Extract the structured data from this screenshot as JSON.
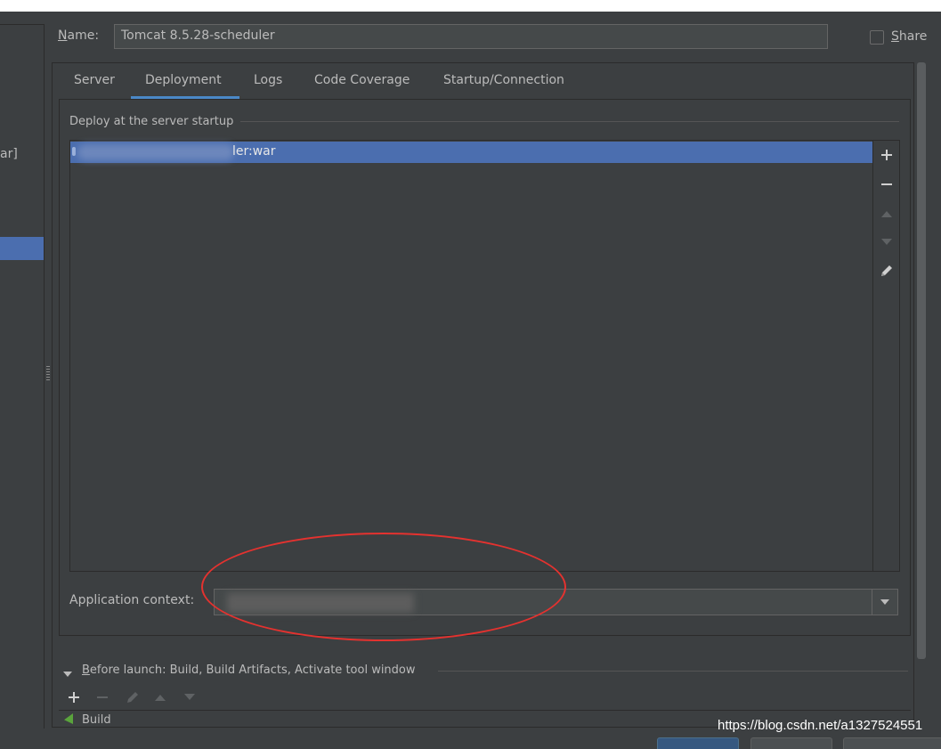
{
  "dialog": {
    "name_label": "Name:",
    "name_value": "Tomcat 8.5.28-scheduler",
    "share_label": "Share",
    "share_checked": false
  },
  "left_panel": {
    "fragment_text": "ar]"
  },
  "tabs": [
    {
      "label": "Server",
      "selected": false
    },
    {
      "label": "Deployment",
      "selected": true
    },
    {
      "label": "Logs",
      "selected": false
    },
    {
      "label": "Code Coverage",
      "selected": false
    },
    {
      "label": "Startup/Connection",
      "selected": false
    }
  ],
  "deployment": {
    "group_title": "Deploy at the server startup",
    "artifacts": [
      {
        "visible_suffix": "ler:war",
        "selected": true
      }
    ],
    "side_tools": [
      {
        "icon": "plus-icon",
        "enabled": true
      },
      {
        "icon": "minus-icon",
        "enabled": true
      },
      {
        "icon": "move-up-icon",
        "enabled": false
      },
      {
        "icon": "move-down-icon",
        "enabled": false
      },
      {
        "icon": "pencil-icon",
        "enabled": true
      }
    ],
    "app_context_label": "Application context:"
  },
  "before_launch": {
    "label_prefix": "B",
    "label_rest": "efore launch: Build, Build Artifacts, Activate tool window",
    "item_partial": "Build"
  },
  "watermark": "https://blog.csdn.net/a1327524551",
  "colors": {
    "background": "#3c3f41",
    "selection": "#4b6eaf",
    "tab_underline": "#4a88c7",
    "annotation": "#e4322f"
  }
}
